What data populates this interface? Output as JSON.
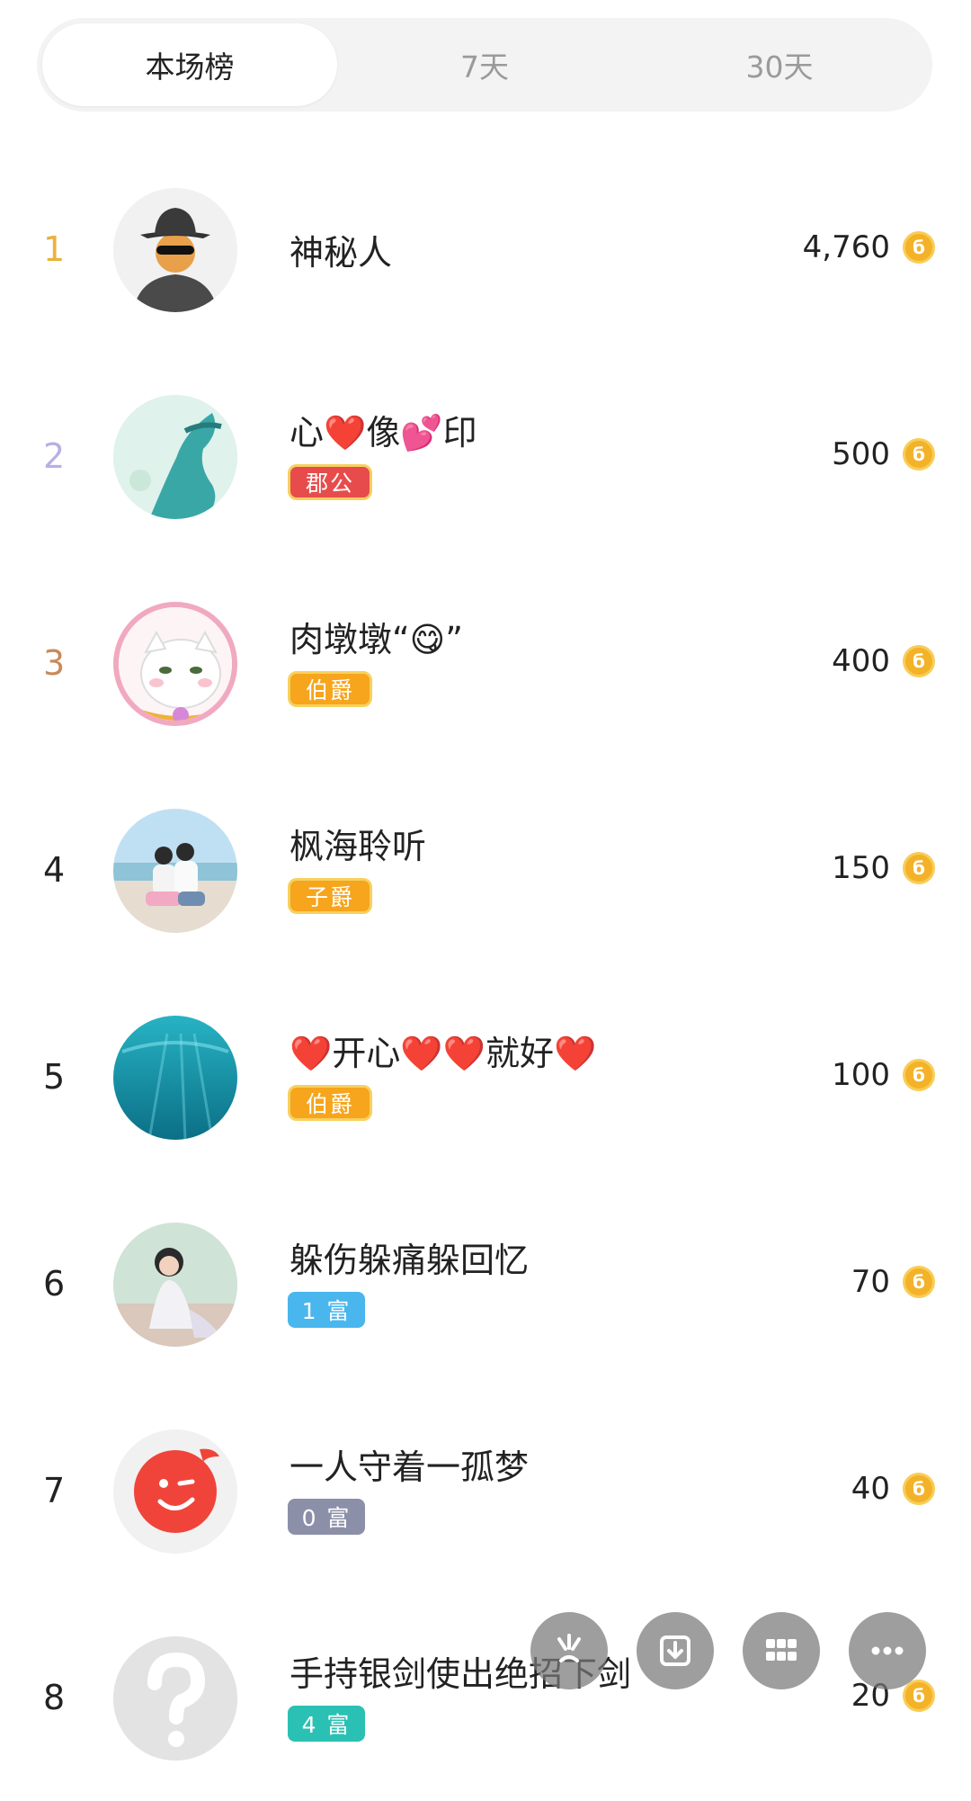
{
  "tabs": [
    {
      "label": "本场榜",
      "active": true
    },
    {
      "label": "7天",
      "active": false
    },
    {
      "label": "30天",
      "active": false
    }
  ],
  "ranking": [
    {
      "rank": "1",
      "name": "神秘人",
      "score": "4,760",
      "badge": null
    },
    {
      "rank": "2",
      "name": "心❤️像💕印",
      "score": "500",
      "badge": "郡公"
    },
    {
      "rank": "3",
      "name": "肉墩墩“😋”",
      "score": "400",
      "badge": "伯爵"
    },
    {
      "rank": "4",
      "name": "枫海聆听",
      "score": "150",
      "badge": "子爵"
    },
    {
      "rank": "5",
      "name": "❤️开心❤️❤️就好❤️",
      "score": "100",
      "badge": "伯爵"
    },
    {
      "rank": "6",
      "name": "躲伤躲痛躲回忆",
      "score": "70",
      "badge": "1 富"
    },
    {
      "rank": "7",
      "name": "一人守着一孤梦",
      "score": "40",
      "badge": "0 富"
    },
    {
      "rank": "8",
      "name": "手持银剑使出绝招下剑",
      "score": "20",
      "badge": "4 富"
    }
  ],
  "coin_symbol": "б",
  "colors": {
    "rank1": "#e9b23a",
    "rank2": "#b6b0e4",
    "rank3": "#c88a58",
    "coin": "#f3b227",
    "heart": "#e0232e"
  },
  "fab_icons": [
    "sparkle-icon",
    "download-icon",
    "grid-icon",
    "more-icon"
  ]
}
